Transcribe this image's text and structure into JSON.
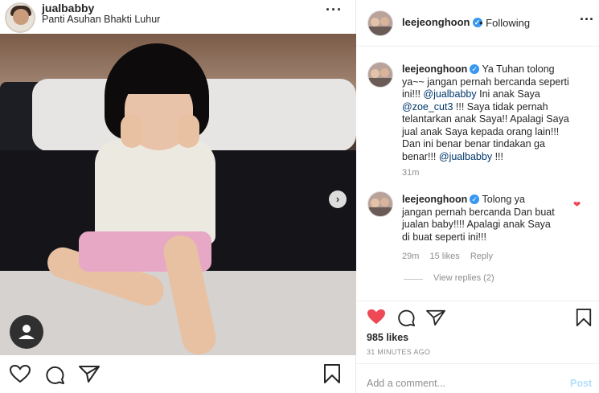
{
  "left_post": {
    "username": "jualbabby",
    "location": "Panti Asuhan Bhakti Luhur",
    "more_icon": "ellipsis-icon",
    "carousel_next_icon": "chevron-right-icon",
    "tag_icon": "tagged-user-icon",
    "actions": [
      "heart-icon",
      "comment-icon",
      "share-icon",
      "bookmark-icon"
    ]
  },
  "right_panel": {
    "header": {
      "username": "leejeonghoon",
      "verified_icon": "verified-badge-icon",
      "follow_status": "• Following",
      "more_icon": "ellipsis-icon"
    },
    "comments": [
      {
        "username": "leejeonghoon",
        "lines": [
          "Ya Tuhan tolong",
          "ya~~ jangan pernah bercanda seperti",
          "ini!!! @jualbabby Ini anak Saya",
          "@zoe_cut3 !!! Saya tidak pernah",
          "telantarkan anak Saya!! Apalagi Saya",
          "jual anak Saya kepada orang lain!!!",
          "Dan ini benar benar tindakan ga",
          "benar!!! @jualbabby !!!"
        ],
        "time": "31m"
      },
      {
        "username": "leejeonghoon",
        "lines": [
          "Tolong ya",
          "jangan pernah bercanda Dan buat",
          "jualan baby!!!! Apalagi anak Saya",
          "di buat seperti ini!!!"
        ],
        "time": "29m",
        "likes": "15 likes",
        "reply": "Reply",
        "view_replies": "View replies (2)"
      }
    ],
    "likes_count": "985 likes",
    "time_ago": "31 MINUTES AGO",
    "add_comment_placeholder": "Add a comment...",
    "post_label": "Post",
    "colors": {
      "like_red": "#ed4956",
      "mention_blue": "#00376b",
      "verified_blue": "#3897f0",
      "post_disabled": "#b2dffc"
    }
  }
}
